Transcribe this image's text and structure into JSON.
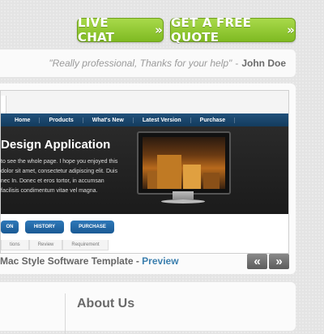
{
  "header": {
    "live_chat": "LIVE CHAT",
    "free_quote": "GET A FREE QUOTE",
    "arrow": "»"
  },
  "testimonial": {
    "text": "\"Really professional, Thanks for your help\"",
    "dash": "-",
    "author": "John Doe"
  },
  "slide": {
    "nav": [
      "Home",
      "Products",
      "What's New",
      "Latest Version",
      "Purchase"
    ],
    "hero_title": "Design Application",
    "hero_body": "to see the whole page. I hope you enjoyed this dolor sit amet, consectetur adipiscing elit. Duis nec In. Donec et eros tortor, in accumsan facilisis condimentum vitae vel magna.",
    "buttons": [
      "ON",
      "HISTORY",
      "PURCHASE"
    ],
    "subtabs": [
      "tions",
      "Review",
      "Requirement"
    ]
  },
  "caption": {
    "title": "Mac Style Software Template - ",
    "link": "Preview"
  },
  "slider_controls": {
    "prev": "«",
    "next": "»"
  },
  "about": {
    "heading": "About Us"
  },
  "colors": {
    "cta_green": "#8cc63f",
    "nav_blue": "#1d4e78",
    "link_blue": "#3b7fae"
  }
}
